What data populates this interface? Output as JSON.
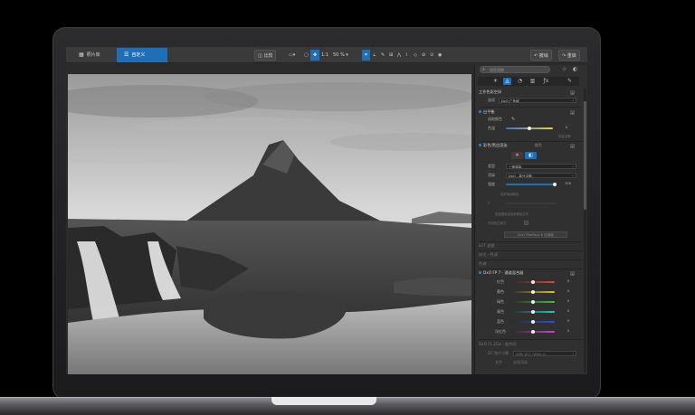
{
  "toolbar": {
    "tab_library": "照片库",
    "tab_customize": "自定义",
    "compare": "比较",
    "one_to_one": "1:1",
    "zoom": "50 %",
    "undo": "撤销",
    "redo": "重做"
  },
  "panel": {
    "search_placeholder": "搜索调整",
    "working_space": {
      "title": "工作色彩空间",
      "label": "选项",
      "value": "DxO 广色域"
    },
    "white_balance": {
      "title": "白平衡",
      "picker_label": "选取颜色",
      "temp_label": "色温",
      "temp_value": "0",
      "reset_label": "恢复设置"
    },
    "color_rendering": {
      "title": "彩色/黑白渲染",
      "tag": "颜色",
      "category_label": "类型",
      "category_value": "一般渲染",
      "rendering_label": "渲染",
      "rendering_value": "DxO - 高分平衡",
      "intensity_label": "强度",
      "intensity_value": "100",
      "note": "保护饱和颜色",
      "note_value": "0",
      "note2": "恢复颜色信息和原始文件",
      "note3": "光线校正模式",
      "filmpack_btn": "DxO FilmPack 6 试用版",
      "lut": "LUT 滤镜",
      "style": "样式 - 色调",
      "tone": "色调"
    },
    "filmpack": {
      "title": "DxO FP 7 - 通道混合器",
      "rows": [
        {
          "label": "红色",
          "value": "0",
          "color": "#e04040"
        },
        {
          "label": "黄色",
          "value": "0",
          "color": "#e0c030"
        },
        {
          "label": "绿色",
          "value": "0",
          "color": "#40c040"
        },
        {
          "label": "青色",
          "value": "0",
          "color": "#30c0d0"
        },
        {
          "label": "蓝色",
          "value": "0",
          "color": "#3050e0"
        },
        {
          "label": "洋红色",
          "value": "0",
          "color": "#d040c0"
        }
      ]
    },
    "footer": {
      "item1": "DxO FL 2Go - 胶片网",
      "item2": "DC 胶片引擎",
      "item2_value": "ARRI D21 (Wide-C)",
      "item3": "文件",
      "item3_value": "全局渲染"
    }
  },
  "colors": {
    "accent": "#1f6fb8",
    "panel_bg": "#303030",
    "toolbar_bg": "#3a3a3a"
  }
}
